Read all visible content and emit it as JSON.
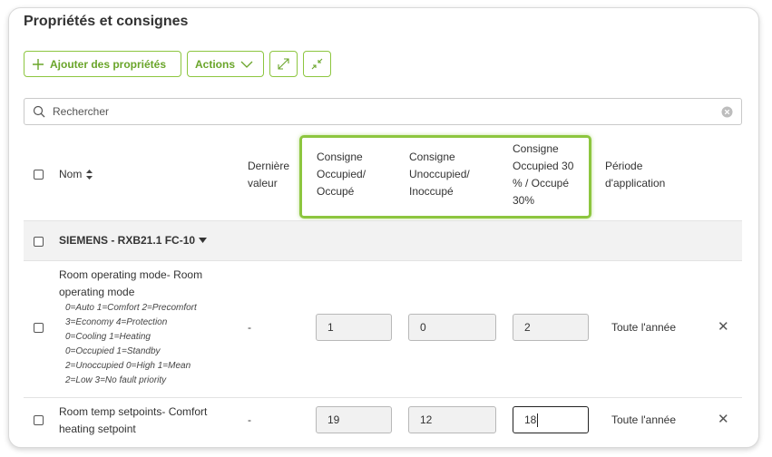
{
  "title": "Propriétés et consignes",
  "toolbar": {
    "add_label": "Ajouter des propriétés",
    "actions_label": "Actions",
    "expand_icon": "expand-icon",
    "collapse_icon": "collapse-icon"
  },
  "search": {
    "placeholder": "Rechercher"
  },
  "columns": {
    "name": "Nom",
    "last_value": [
      "Dernière",
      "valeur"
    ],
    "occupied": [
      "Consigne",
      "Occupied/",
      "Occupé"
    ],
    "unoccupied": [
      "Consigne",
      "Unoccupied/",
      "Inoccupé"
    ],
    "occupied30": [
      "Consigne",
      "Occupied 30",
      "% / Occupé",
      "30%"
    ],
    "period": [
      "Période",
      "d'application"
    ]
  },
  "group": {
    "label": "SIEMENS - RXB21.1 FC-10"
  },
  "rows": [
    {
      "name": [
        "Room operating mode- Room",
        "operating mode"
      ],
      "description": [
        "0=Auto 1=Comfort 2=Precomfort",
        "3=Economy 4=Protection",
        "0=Cooling 1=Heating",
        "0=Occupied 1=Standby",
        "2=Unoccupied 0=High 1=Mean",
        "2=Low 3=No fault priority"
      ],
      "last_value": "-",
      "occupied": "1",
      "unoccupied": "0",
      "occupied30": "2",
      "period": "Toute l'année"
    },
    {
      "name": [
        "Room temp setpoints- Comfort",
        "heating setpoint"
      ],
      "last_value": "-",
      "occupied": "19",
      "unoccupied": "12",
      "occupied30": "18",
      "period": "Toute l'année"
    }
  ],
  "colors": {
    "accent": "#8dc63f",
    "accent_text": "#6aa52a",
    "group_bg": "#f2f2f2"
  }
}
